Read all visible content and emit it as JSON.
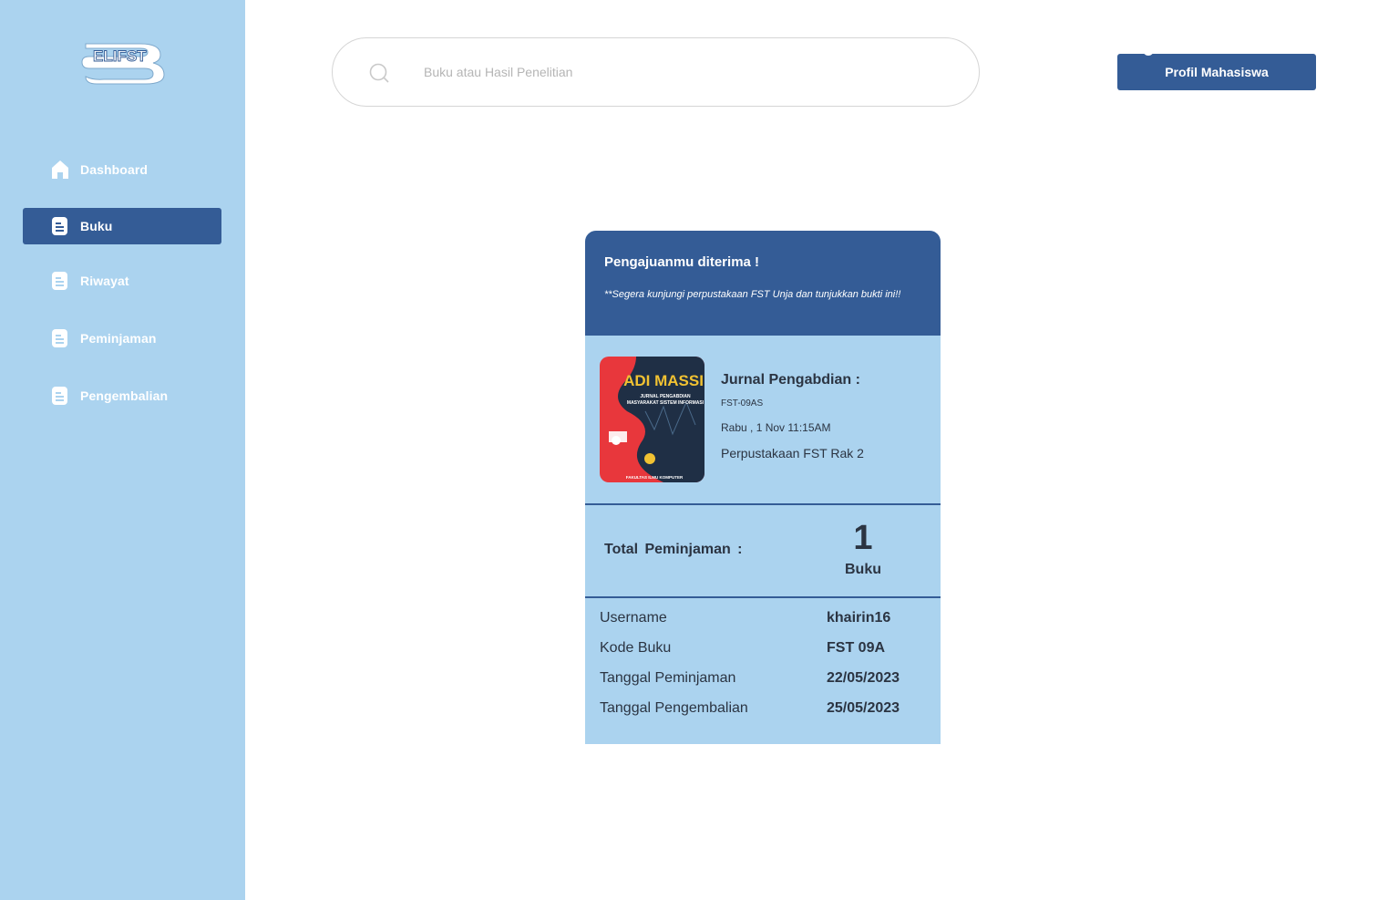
{
  "app": {
    "logo_text": "ELIFST"
  },
  "sidebar": {
    "items": [
      {
        "label": "Dashboard",
        "icon": "home-icon",
        "active": false
      },
      {
        "label": "Buku",
        "icon": "document-icon",
        "active": true
      },
      {
        "label": "Riwayat",
        "icon": "document-icon",
        "active": false
      },
      {
        "label": "Peminjaman",
        "icon": "document-icon",
        "active": false
      },
      {
        "label": "Pengembalian",
        "icon": "document-icon",
        "active": false
      }
    ]
  },
  "search": {
    "placeholder": "Buku atau Hasil Penelitian",
    "value": ""
  },
  "header": {
    "profile_button": "Profil Mahasiswa"
  },
  "receipt": {
    "title": "Pengajuanmu diterima !",
    "note": "**Segera kunjungi perpustakaan FST Unja dan tunjukkan bukti ini!!",
    "book": {
      "cover_title": "ADI MASSI",
      "cover_subtitle_1": "JURNAL PENGABDIAN",
      "cover_subtitle_2": "MASYARAKAT SISTEM INFORMASI",
      "cover_footer": "FAKULTAS ILMU KOMPUTER",
      "title": "Jurnal Pengabdian :",
      "code": "FST-09AS",
      "date": "Rabu , 1 Nov 11:15AM",
      "location": "Perpustakaan FST Rak 2"
    },
    "total": {
      "label": "Total  Peminjaman  :",
      "value": "1",
      "unit": "Buku"
    },
    "details": [
      {
        "key": "Username",
        "value": "khairin16"
      },
      {
        "key": "Kode Buku",
        "value": "FST 09A"
      },
      {
        "key": "Tanggal Peminjaman",
        "value": "22/05/2023"
      },
      {
        "key": "Tanggal Pengembalian",
        "value": "25/05/2023"
      }
    ]
  },
  "colors": {
    "sidebar_bg": "#abd3ef",
    "primary": "#345c96",
    "card_bg": "#abd3ef",
    "text": "#2b3442"
  }
}
